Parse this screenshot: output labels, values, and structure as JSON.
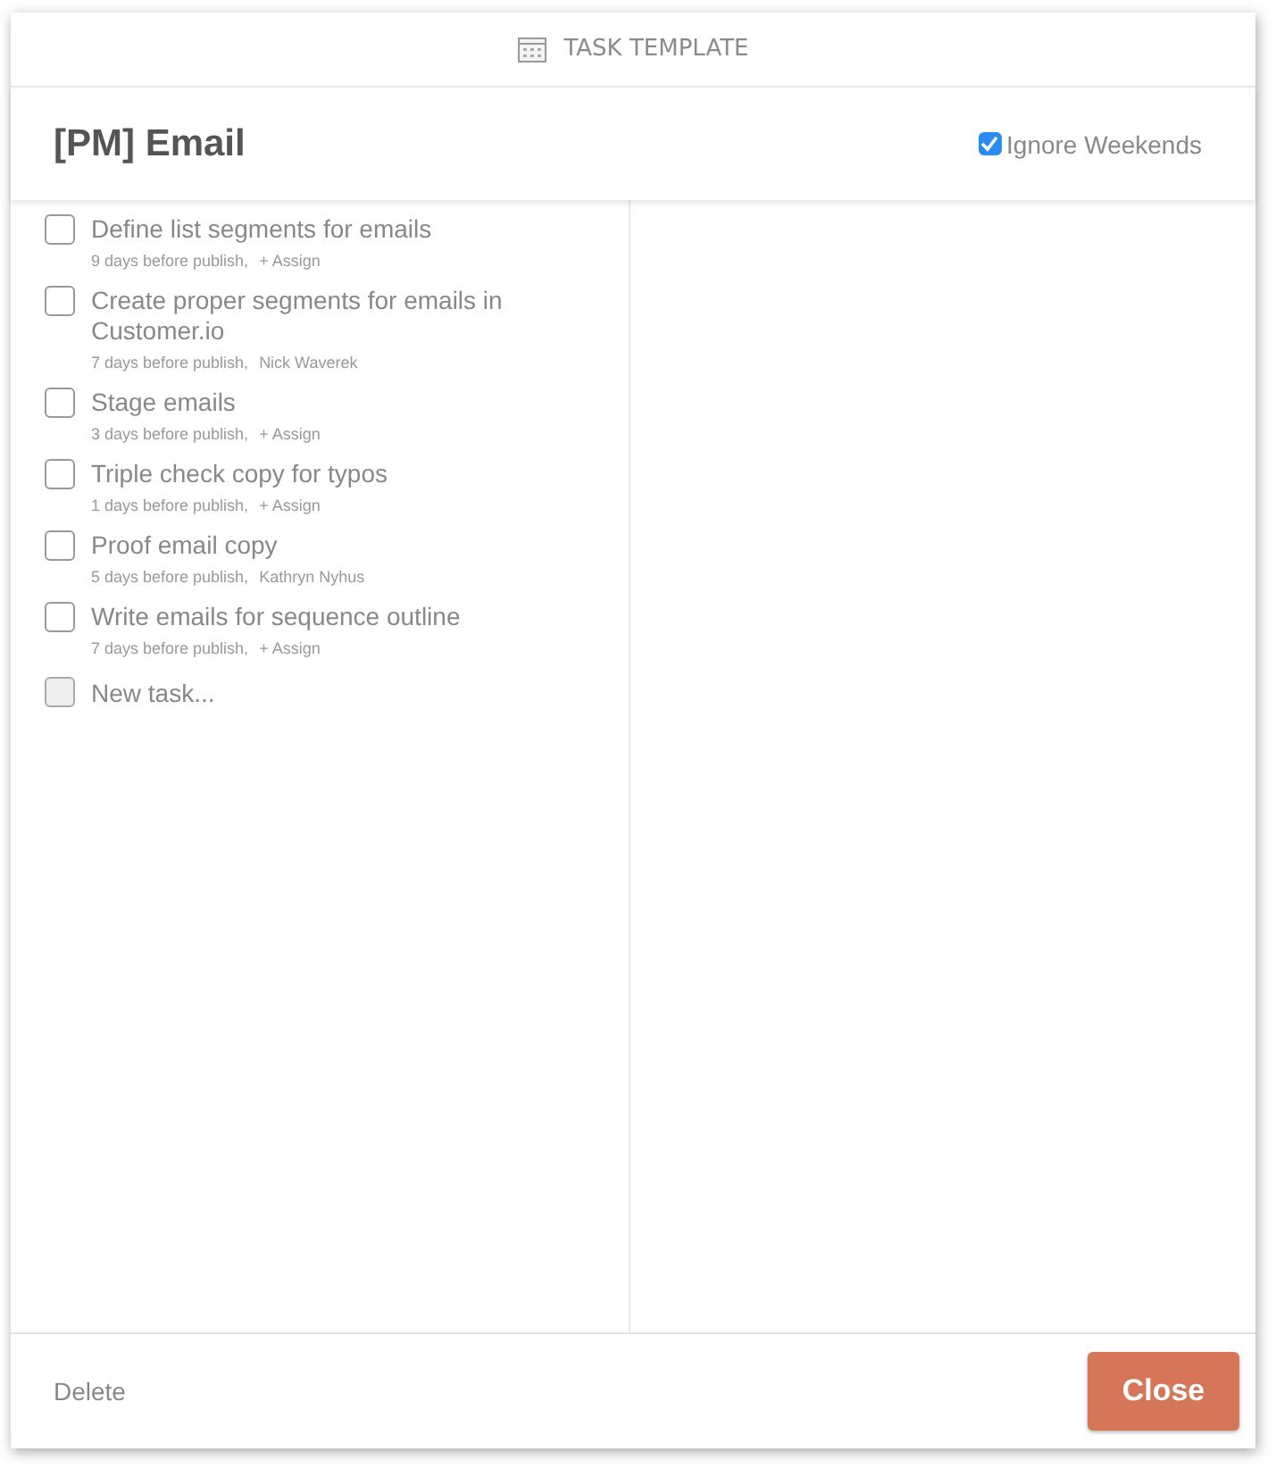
{
  "dialog": {
    "title": "TASK TEMPLATE"
  },
  "template": {
    "name": "[PM] Email",
    "ignore_weekends": {
      "label": "Ignore Weekends",
      "checked": true
    }
  },
  "tasks": [
    {
      "title": "Define list segments for emails",
      "due": "9 days before publish,",
      "assignee": "+ Assign",
      "checked": false
    },
    {
      "title": "Create proper segments for emails in Customer.io",
      "due": "7 days before publish,",
      "assignee": "Nick Waverek",
      "checked": false
    },
    {
      "title": "Stage emails",
      "due": "3 days before publish,",
      "assignee": "+ Assign",
      "checked": false
    },
    {
      "title": "Triple check copy for typos",
      "due": "1 days before publish,",
      "assignee": "+ Assign",
      "checked": false
    },
    {
      "title": "Proof email copy",
      "due": "5 days before publish,",
      "assignee": "Kathryn Nyhus",
      "checked": false
    },
    {
      "title": "Write emails for sequence outline",
      "due": "7 days before publish,",
      "assignee": "+ Assign",
      "checked": false
    }
  ],
  "new_task": {
    "placeholder": "New task...",
    "disabled": true
  },
  "footer": {
    "delete": "Delete",
    "close": "Close"
  }
}
